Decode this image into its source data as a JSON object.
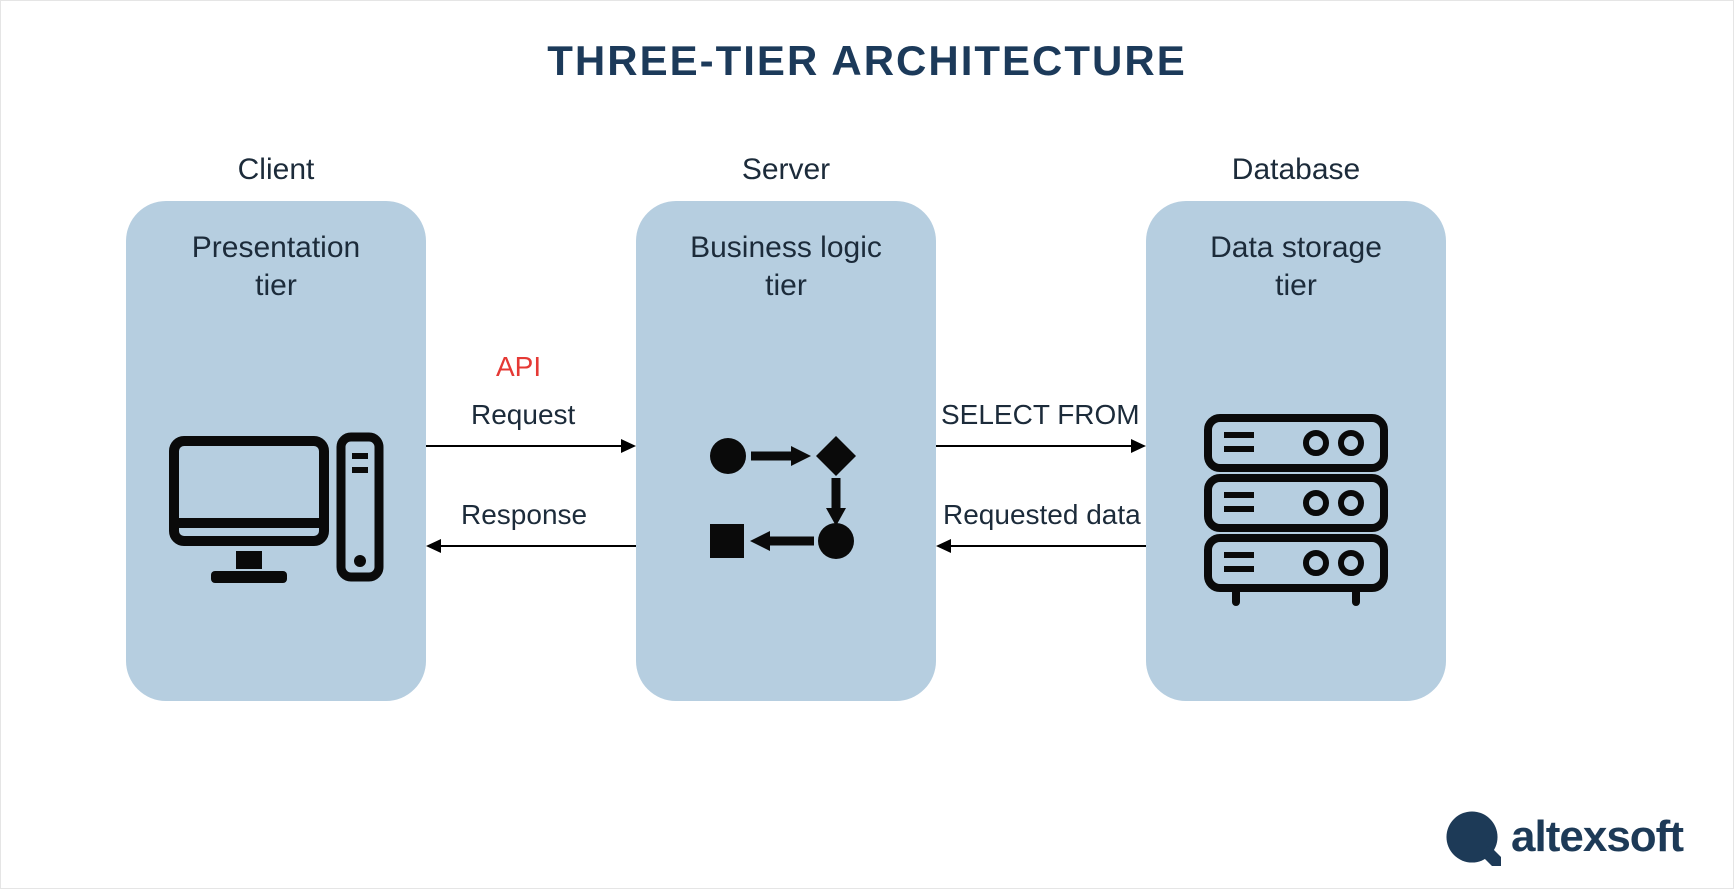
{
  "title": "THREE-TIER ARCHITECTURE",
  "tiers": {
    "client": {
      "label": "Client",
      "box_title_line1": "Presentation",
      "box_title_line2": "tier"
    },
    "server": {
      "label": "Server",
      "box_title_line1": "Business logic",
      "box_title_line2": "tier"
    },
    "database": {
      "label": "Database",
      "box_title_line1": "Data storage",
      "box_title_line2": "tier"
    }
  },
  "arrows": {
    "api": "API",
    "request": "Request",
    "response": "Response",
    "select_from": "SELECT FROM",
    "requested_data": "Requested data"
  },
  "icons": {
    "computer": "computer-icon",
    "flowchart": "flowchart-icon",
    "server_rack": "server-rack-icon"
  },
  "brand": {
    "name": "altexsoft"
  },
  "colors": {
    "title": "#1c3a5a",
    "text": "#1c2b3a",
    "box_bg": "#b6cee0",
    "api": "#e53935",
    "logo": "#1d3a57"
  }
}
